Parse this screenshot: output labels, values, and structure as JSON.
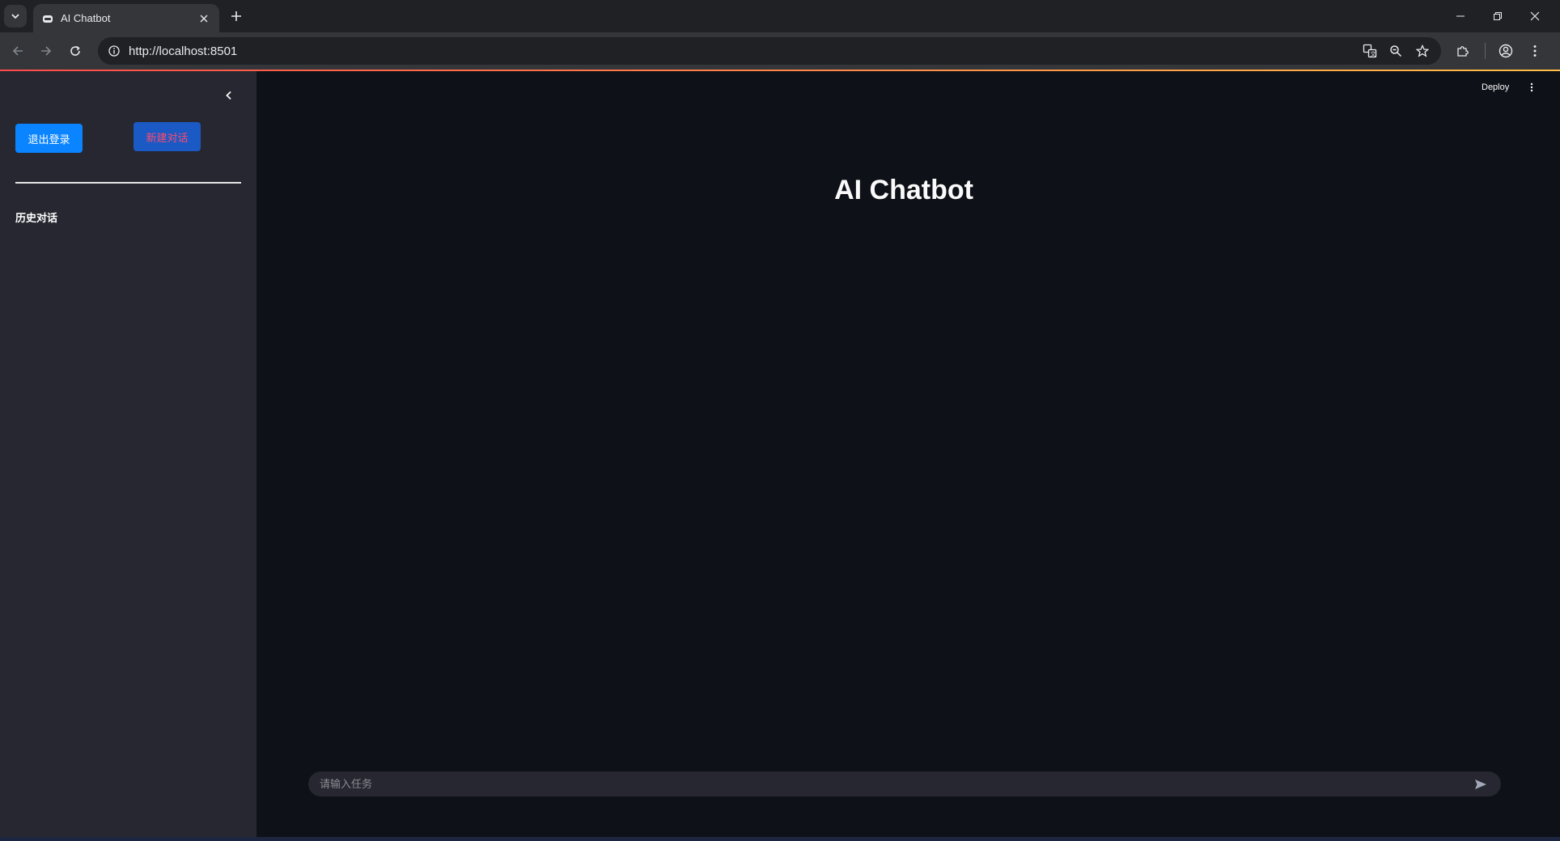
{
  "browser": {
    "tab_title": "AI Chatbot",
    "url": "http://localhost:8501"
  },
  "sidebar": {
    "logout_label": "退出登录",
    "new_chat_label": "新建对话",
    "history_title": "历史对话"
  },
  "header": {
    "deploy_label": "Deploy"
  },
  "main": {
    "title": "AI Chatbot"
  },
  "chat_input": {
    "placeholder": "请输入任务"
  },
  "colors": {
    "app_background": "#0e1117",
    "sidebar_background": "#262730",
    "logout_button": "#0a84ff",
    "new_chat_button": "#1b59c4",
    "new_chat_text": "#ff4b6e"
  },
  "icons": {
    "tab_search": "chevron-down-icon",
    "favicon": "bot-icon",
    "tab_close": "close-icon",
    "new_tab": "plus-icon",
    "back": "arrow-left-icon",
    "forward": "arrow-right-icon",
    "reload": "reload-icon",
    "site_info": "info-icon",
    "translate": "translate-icon",
    "zoom": "zoom-out-icon",
    "bookmark": "star-icon",
    "extensions": "puzzle-icon",
    "profile": "account-icon",
    "browser_menu": "kebab-icon",
    "sidebar_collapse": "chevron-left-icon",
    "main_menu": "kebab-icon",
    "send": "send-icon"
  }
}
